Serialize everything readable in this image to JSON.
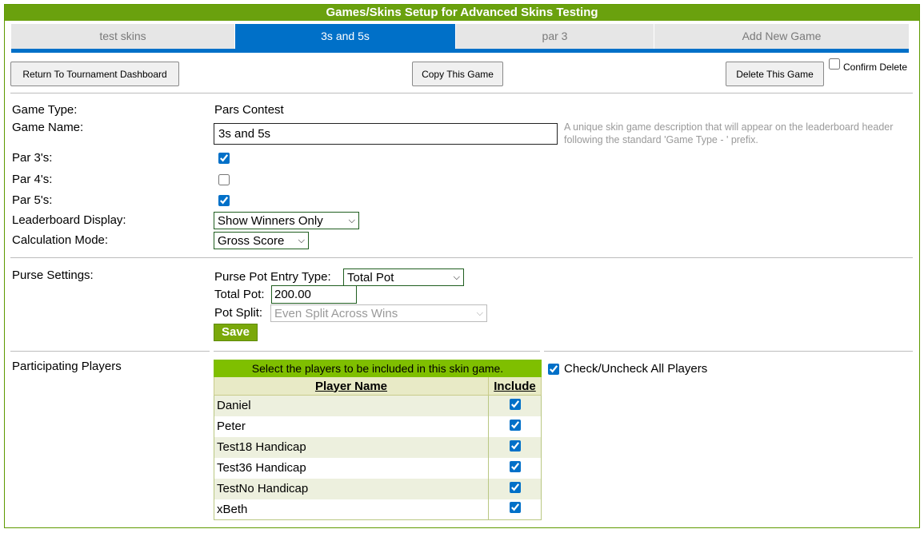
{
  "title": "Games/Skins Setup for Advanced Skins Testing",
  "tabs": [
    {
      "label": "test skins"
    },
    {
      "label": "3s and 5s"
    },
    {
      "label": "par 3"
    },
    {
      "label": "Add New Game"
    }
  ],
  "toolbar": {
    "return_label": "Return To Tournament Dashboard",
    "copy_label": "Copy This Game",
    "delete_label": "Delete This Game",
    "confirm_delete_label": "Confirm Delete"
  },
  "form": {
    "game_type_label": "Game Type:",
    "game_type_value": "Pars Contest",
    "game_name_label": "Game Name:",
    "game_name_value": "3s and 5s",
    "game_name_hint": "A unique skin game description that will appear on the leaderboard header following the standard 'Game Type - ' prefix.",
    "par3_label": "Par 3's:",
    "par4_label": "Par 4's:",
    "par5_label": "Par 5's:",
    "leaderboard_label": "Leaderboard Display:",
    "leaderboard_value": "Show Winners Only",
    "calc_label": "Calculation Mode:",
    "calc_value": "Gross Score"
  },
  "purse": {
    "section_label": "Purse Settings:",
    "entry_type_label": "Purse Pot Entry Type:",
    "entry_type_value": "Total Pot",
    "total_pot_label": "Total Pot:",
    "total_pot_value": "200.00",
    "pot_split_label": "Pot Split:",
    "pot_split_value": "Even Split Across Wins",
    "save_label": "Save"
  },
  "players": {
    "section_label": "Participating Players",
    "caption": "Select the players to be included in this skin game.",
    "col_name": "Player Name",
    "col_include": "Include",
    "check_all_label": "Check/Uncheck All Players",
    "rows": [
      {
        "name": "Daniel"
      },
      {
        "name": "Peter"
      },
      {
        "name": "Test18 Handicap"
      },
      {
        "name": "Test36 Handicap"
      },
      {
        "name": "TestNo Handicap"
      },
      {
        "name": "xBeth"
      }
    ]
  }
}
